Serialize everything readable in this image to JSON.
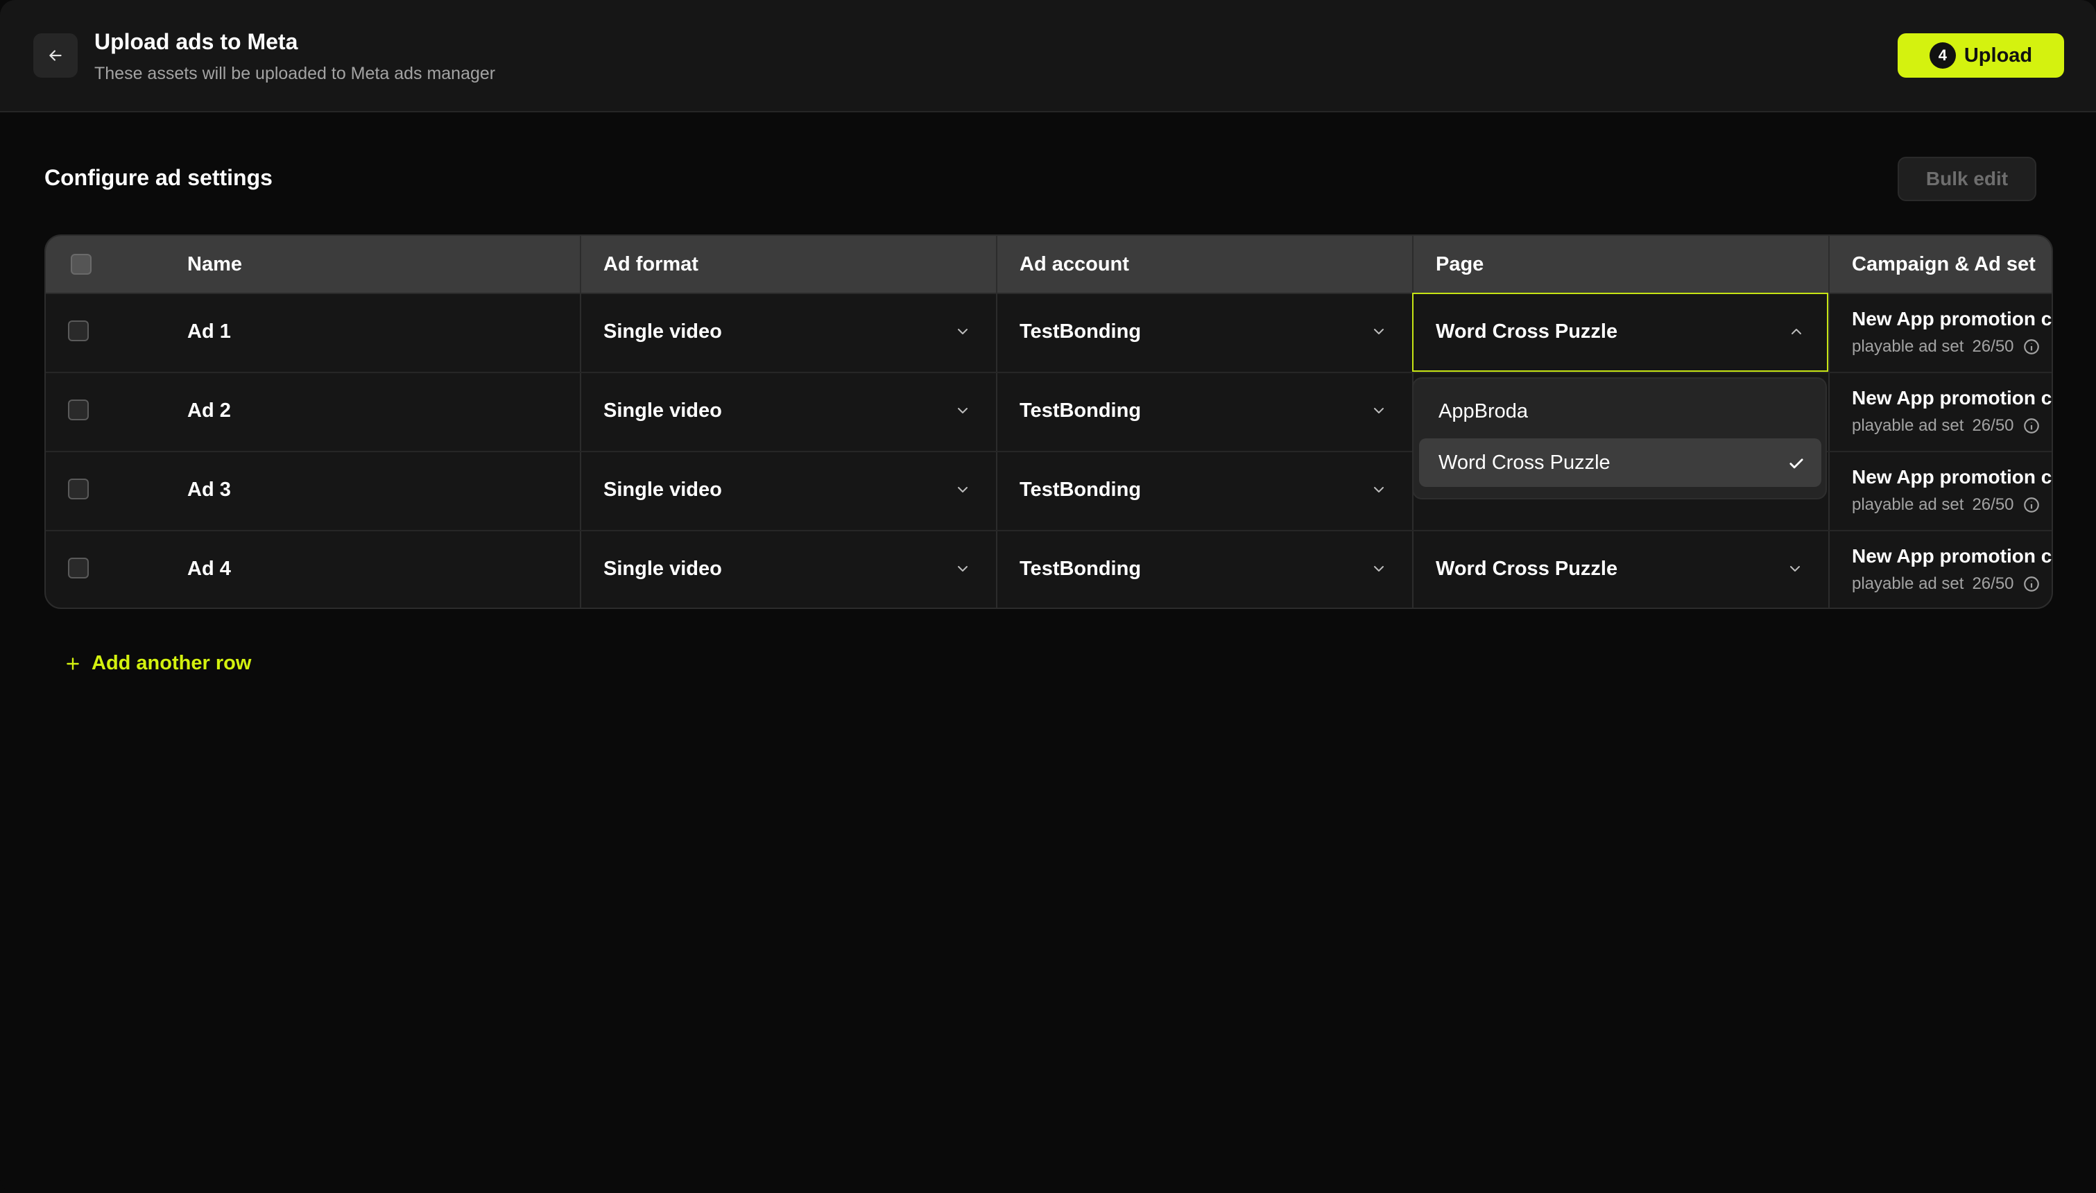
{
  "header": {
    "title": "Upload ads to Meta",
    "subtitle": "These assets will be uploaded to Meta ads manager",
    "upload_count": "4",
    "upload_label": "Upload"
  },
  "section": {
    "title": "Configure ad settings",
    "bulk_edit_label": "Bulk edit"
  },
  "table": {
    "columns": [
      "Name",
      "Ad format",
      "Ad account",
      "Page",
      "Campaign & Ad set"
    ],
    "rows": [
      {
        "name": "Ad 1",
        "format": "Single video",
        "account": "TestBonding",
        "page": "Word Cross Puzzle",
        "campaign": "New App promotion c",
        "adset": "playable ad set",
        "count": "26/50"
      },
      {
        "name": "Ad 2",
        "format": "Single video",
        "account": "TestBonding",
        "page": "",
        "campaign": "New App promotion c",
        "adset": "playable ad set",
        "count": "26/50"
      },
      {
        "name": "Ad 3",
        "format": "Single video",
        "account": "TestBonding",
        "page": "",
        "campaign": "New App promotion c",
        "adset": "playable ad set",
        "count": "26/50"
      },
      {
        "name": "Ad 4",
        "format": "Single video",
        "account": "TestBonding",
        "page": "Word Cross Puzzle",
        "campaign": "New App promotion c",
        "adset": "playable ad set",
        "count": "26/50"
      }
    ]
  },
  "page_dropdown": {
    "options": [
      "AppBroda",
      "Word Cross Puzzle"
    ],
    "selected": "Word Cross Puzzle"
  },
  "add_row_label": "Add another row",
  "colors": {
    "accent": "#d4f20f",
    "background": "#0a0a0a",
    "surface": "#161616",
    "header_row": "#3c3c3c"
  },
  "icons": {
    "back": "arrow-left-icon",
    "chevron": "chevron-down-icon",
    "chevron_open": "chevron-up-icon",
    "check": "check-icon",
    "info": "info-icon",
    "plus": "plus-icon"
  }
}
